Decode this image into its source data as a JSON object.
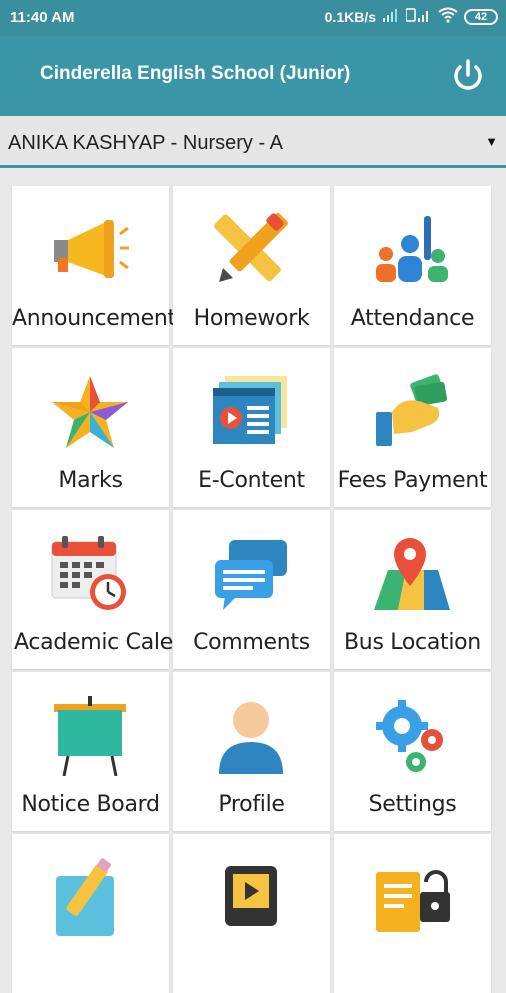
{
  "status_bar": {
    "time": "11:40 AM",
    "network_speed": "0.1KB/s",
    "battery": "42",
    "icons": [
      "signal-icon",
      "volte-signal-icon",
      "wifi-icon",
      "battery-icon"
    ]
  },
  "app_bar": {
    "title": "Cinderella English School (Junior)",
    "power_icon": "power-icon"
  },
  "student_selector": {
    "value": "ANIKA KASHYAP - Nursery - A",
    "arrow": "▼"
  },
  "colors": {
    "primary": "#3a96a6",
    "status_bar": "#3a8f9e",
    "tile_bg": "#ffffff",
    "page_bg": "#e9e9e9"
  },
  "tiles": [
    {
      "label": "Announcement",
      "icon": "megaphone-icon"
    },
    {
      "label": "Homework",
      "icon": "pencil-ruler-icon"
    },
    {
      "label": "Attendance",
      "icon": "people-raised-hand-icon"
    },
    {
      "label": "Marks",
      "icon": "star-icon"
    },
    {
      "label": "E-Content",
      "icon": "video-content-icon"
    },
    {
      "label": "Fees Payment",
      "icon": "hand-money-icon"
    },
    {
      "label": "Academic Calendar",
      "icon": "calendar-clock-icon"
    },
    {
      "label": "Comments",
      "icon": "chat-bubbles-icon"
    },
    {
      "label": "Bus Location",
      "icon": "map-pin-icon"
    },
    {
      "label": "Notice Board",
      "icon": "notice-board-icon"
    },
    {
      "label": "Profile",
      "icon": "user-profile-icon"
    },
    {
      "label": "Settings",
      "icon": "gears-icon"
    },
    {
      "label": "",
      "icon": "edit-document-icon"
    },
    {
      "label": "",
      "icon": "video-player-icon"
    },
    {
      "label": "",
      "icon": "checklist-lock-icon"
    }
  ]
}
